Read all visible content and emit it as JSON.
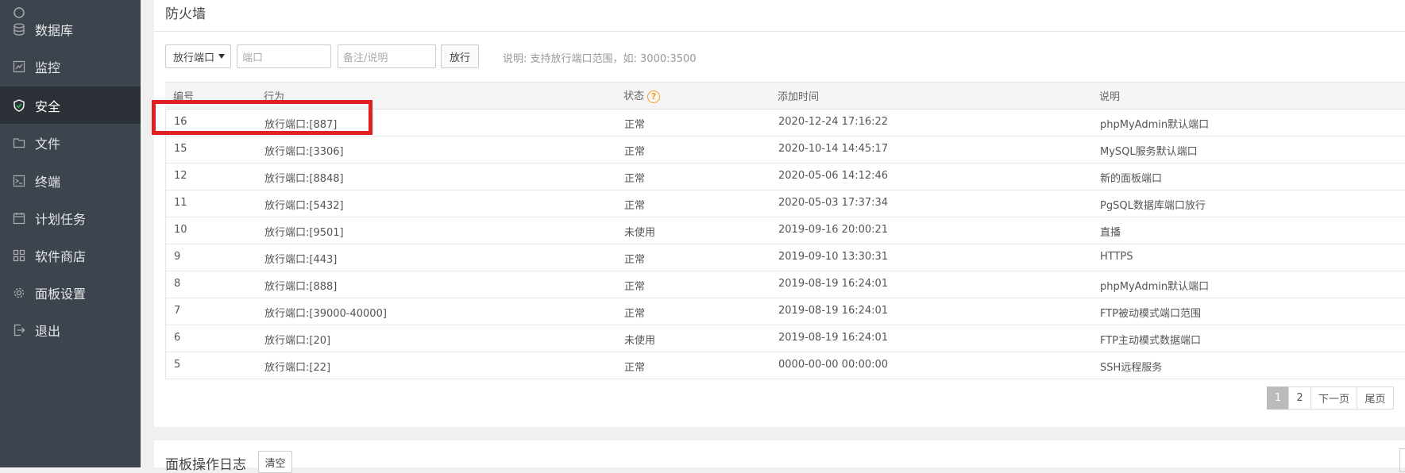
{
  "sidebar": {
    "items": [
      {
        "label": "数据库",
        "icon": "database-icon"
      },
      {
        "label": "监控",
        "icon": "monitor-icon"
      },
      {
        "label": "安全",
        "icon": "shield-icon"
      },
      {
        "label": "文件",
        "icon": "folder-icon"
      },
      {
        "label": "终端",
        "icon": "terminal-icon"
      },
      {
        "label": "计划任务",
        "icon": "calendar-icon"
      },
      {
        "label": "软件商店",
        "icon": "grid-icon"
      },
      {
        "label": "面板设置",
        "icon": "gear-icon"
      },
      {
        "label": "退出",
        "icon": "logout-icon"
      }
    ]
  },
  "firewall": {
    "title": "防火墙",
    "action_select": "放行端口",
    "port_placeholder": "端口",
    "note_placeholder": "备注/说明",
    "submit_label": "放行",
    "hint": "说明: 支持放行端口范围，如: 3000:3500"
  },
  "table": {
    "headers": [
      "编号",
      "行为",
      "状态",
      "添加时间",
      "说明"
    ],
    "rows": [
      {
        "id": "16",
        "action": "放行端口:[887]",
        "status": "正常",
        "time": "2020-12-24 17:16:22",
        "note": "phpMyAdmin默认端口"
      },
      {
        "id": "15",
        "action": "放行端口:[3306]",
        "status": "正常",
        "time": "2020-10-14 14:45:17",
        "note": "MySQL服务默认端口"
      },
      {
        "id": "12",
        "action": "放行端口:[8848]",
        "status": "正常",
        "time": "2020-05-06 14:12:46",
        "note": "新的面板端口"
      },
      {
        "id": "11",
        "action": "放行端口:[5432]",
        "status": "正常",
        "time": "2020-05-03 17:37:34",
        "note": "PgSQL数据库端口放行"
      },
      {
        "id": "10",
        "action": "放行端口:[9501]",
        "status": "未使用",
        "time": "2019-09-16 20:00:21",
        "note": "直播"
      },
      {
        "id": "9",
        "action": "放行端口:[443]",
        "status": "正常",
        "time": "2019-09-10 13:30:31",
        "note": "HTTPS"
      },
      {
        "id": "8",
        "action": "放行端口:[888]",
        "status": "正常",
        "time": "2019-08-19 16:24:01",
        "note": "phpMyAdmin默认端口"
      },
      {
        "id": "7",
        "action": "放行端口:[39000-40000]",
        "status": "正常",
        "time": "2019-08-19 16:24:01",
        "note": "FTP被动模式端口范围"
      },
      {
        "id": "6",
        "action": "放行端口:[20]",
        "status": "未使用",
        "time": "2019-08-19 16:24:01",
        "note": "FTP主动模式数据端口"
      },
      {
        "id": "5",
        "action": "放行端口:[22]",
        "status": "正常",
        "time": "0000-00-00 00:00:00",
        "note": "SSH远程服务"
      }
    ]
  },
  "pagination": {
    "current": "1",
    "page2": "2",
    "next": "下一页",
    "last": "尾页"
  },
  "logs": {
    "title": "面板操作日志",
    "clear_label": "清空"
  }
}
